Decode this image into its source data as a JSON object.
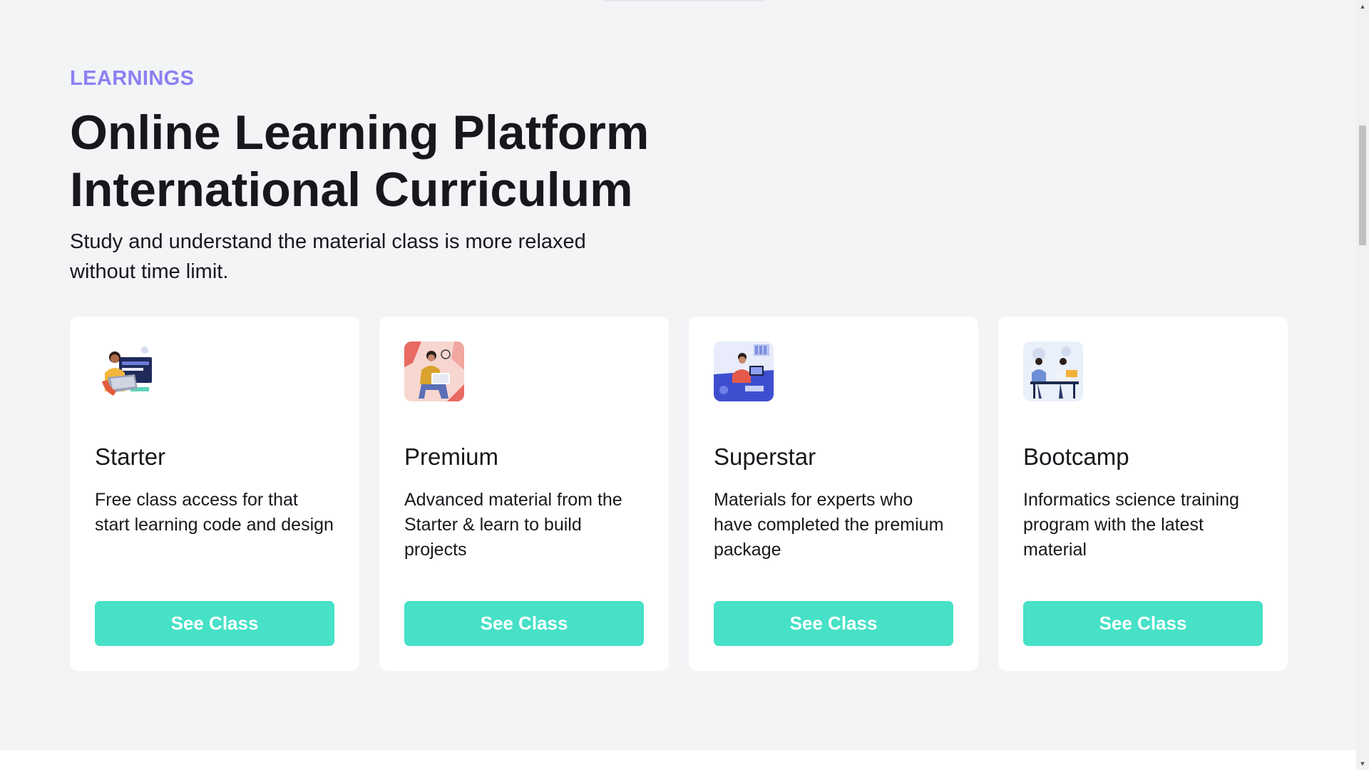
{
  "section": {
    "eyebrow": "LEARNINGS",
    "title_line1": "Online Learning Platform",
    "title_line2": "International Curriculum",
    "subtitle": "Study and understand the material class is more relaxed without time limit."
  },
  "cards": [
    {
      "title": "Starter",
      "description": "Free class access for that start learning code and design",
      "button": "See Class",
      "illustration": "student-with-laptop-illustration"
    },
    {
      "title": "Premium",
      "description": "Advanced material from the Starter & learn to build projects",
      "button": "See Class",
      "illustration": "person-reading-illustration"
    },
    {
      "title": "Superstar",
      "description": "Materials for experts who have completed the premium package",
      "button": "See Class",
      "illustration": "developer-at-desk-illustration"
    },
    {
      "title": "Bootcamp",
      "description": "Informatics science training program with the latest material",
      "button": "See Class",
      "illustration": "team-meeting-illustration"
    }
  ],
  "colors": {
    "accent": "#46e1c7",
    "eyebrow": "#8b80f2",
    "background": "#f3f4f6",
    "card": "#ffffff",
    "text": "#17181c"
  },
  "scrollbar": {
    "up_icon": "triangle-up-icon",
    "down_icon": "triangle-down-icon"
  }
}
